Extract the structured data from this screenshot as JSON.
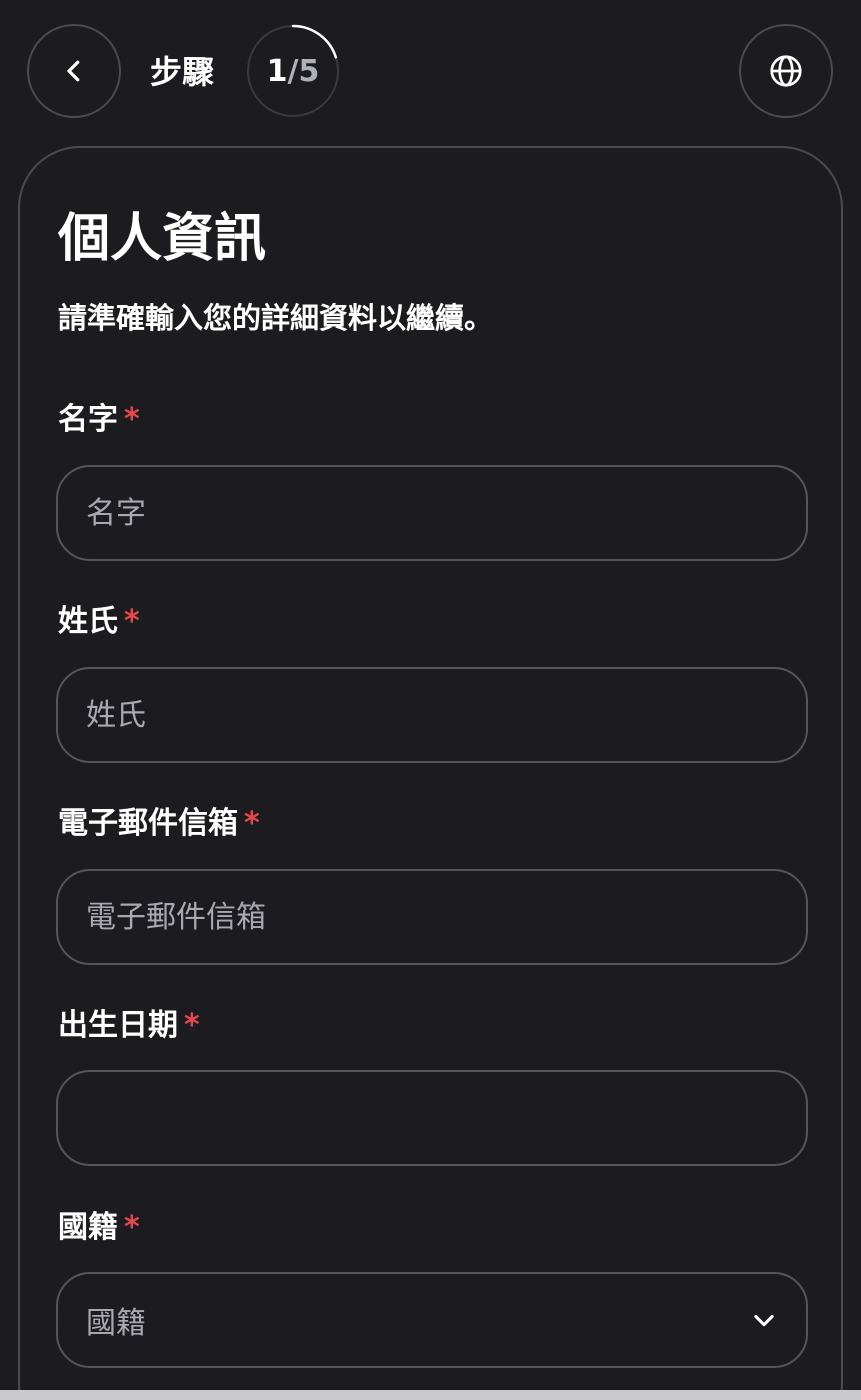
{
  "header": {
    "step_label": "步驟",
    "step_current": "1",
    "step_separator": "/",
    "step_total": "5",
    "progress_fraction": 0.2,
    "back_icon": "chevron-left-icon",
    "language_icon": "globe-icon"
  },
  "card": {
    "title": "個人資訊",
    "subtitle": "請準確輸入您的詳細資料以繼續。"
  },
  "fields": {
    "first_name": {
      "label": "名字",
      "required_mark": "*",
      "placeholder": "名字",
      "value": ""
    },
    "last_name": {
      "label": "姓氏",
      "required_mark": "*",
      "placeholder": "姓氏",
      "value": ""
    },
    "email": {
      "label": "電子郵件信箱",
      "required_mark": "*",
      "placeholder": "電子郵件信箱",
      "value": ""
    },
    "birth_date": {
      "label": "出生日期",
      "required_mark": "*",
      "placeholder": "",
      "value": ""
    },
    "nationality": {
      "label": "國籍",
      "required_mark": "*",
      "selected": "國籍",
      "icon": "chevron-down-icon"
    }
  },
  "colors": {
    "background": "#1b1b20",
    "border": "#4a4a52",
    "required": "#e5484d",
    "placeholder": "#a8a8b0",
    "text": "#ffffff"
  }
}
